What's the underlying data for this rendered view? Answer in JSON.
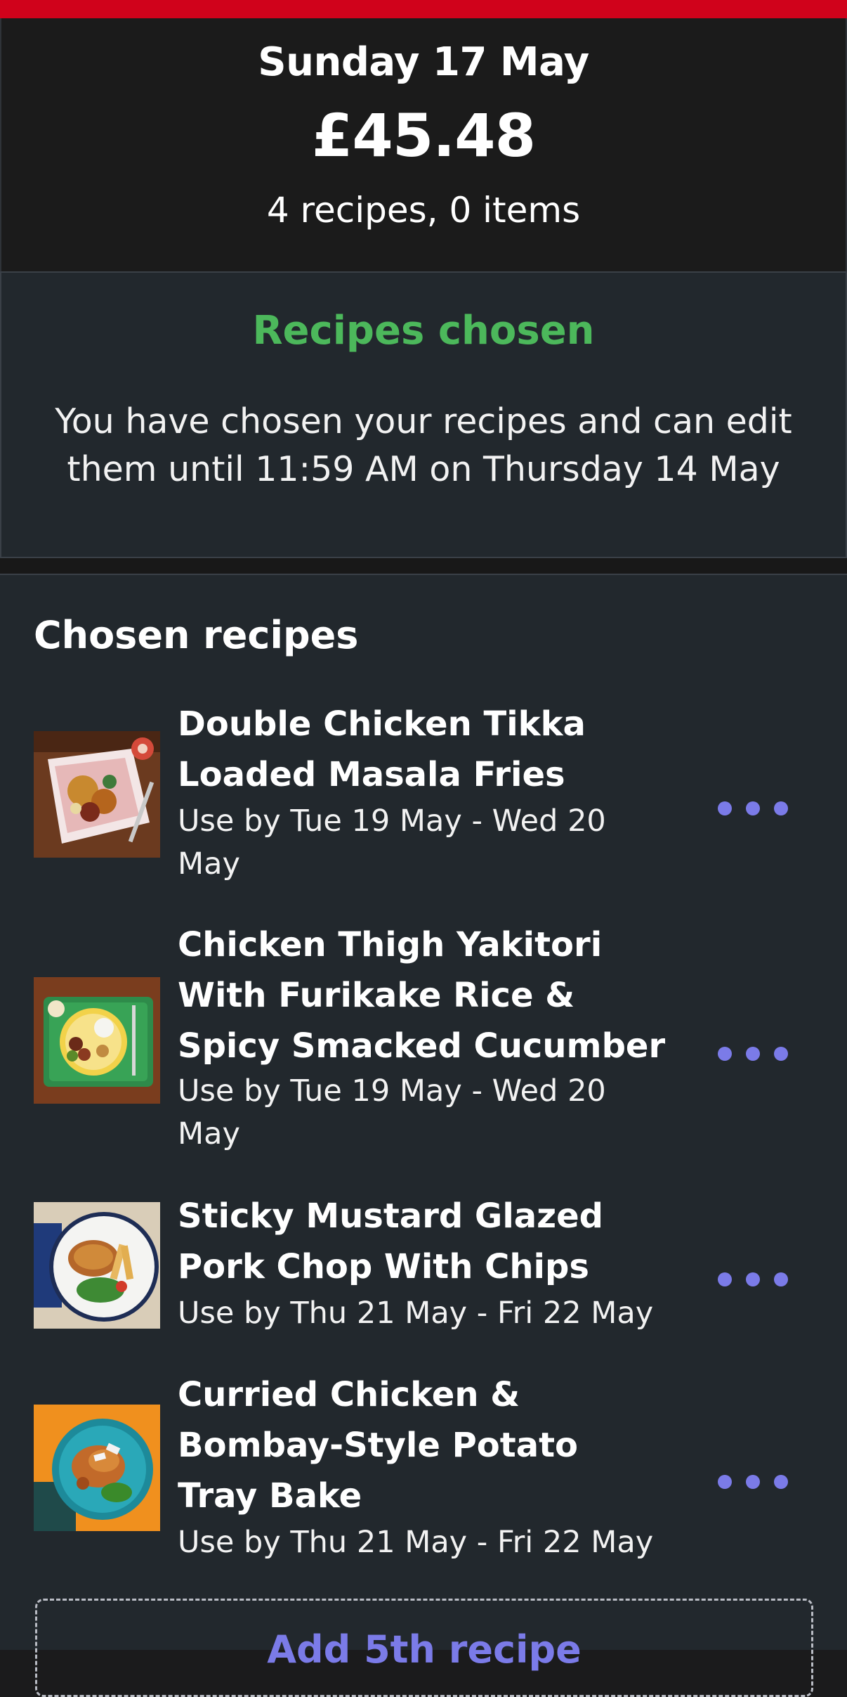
{
  "colors": {
    "accent_bar": "#d0021b",
    "status_green": "#4cb85b",
    "action_purple": "#7b7be8",
    "panel_dark": "#1b1b1b",
    "panel_slate": "#22282d"
  },
  "summary": {
    "date": "Sunday 17 May",
    "price": "£45.48",
    "counts": "4 recipes, 0 items"
  },
  "status": {
    "title": "Recipes chosen",
    "description": "You have chosen your recipes and can edit them until 11:59 AM on Thursday 14 May"
  },
  "chosen": {
    "heading": "Chosen recipes",
    "recipes": [
      {
        "title": "Double Chicken Tikka Loaded Masala Fries",
        "use_by": "Use by Tue 19 May - Wed 20 May",
        "image_icon": "fries-dish-photo",
        "more_icon": "more-options-icon"
      },
      {
        "title": "Chicken Thigh Yakitori With Furikake Rice & Spicy Smacked Cucumber",
        "use_by": "Use by Tue 19 May - Wed 20 May",
        "image_icon": "yakitori-tray-photo",
        "more_icon": "more-options-icon"
      },
      {
        "title": "Sticky Mustard Glazed Pork Chop With Chips",
        "use_by": "Use by Thu 21 May - Fri 22 May",
        "image_icon": "pork-chop-plate-photo",
        "more_icon": "more-options-icon"
      },
      {
        "title": "Curried Chicken & Bombay-Style Potato Tray Bake",
        "use_by": "Use by Thu 21 May - Fri 22 May",
        "image_icon": "curry-traybake-photo",
        "more_icon": "more-options-icon"
      }
    ],
    "add_button": "Add 5th recipe"
  }
}
